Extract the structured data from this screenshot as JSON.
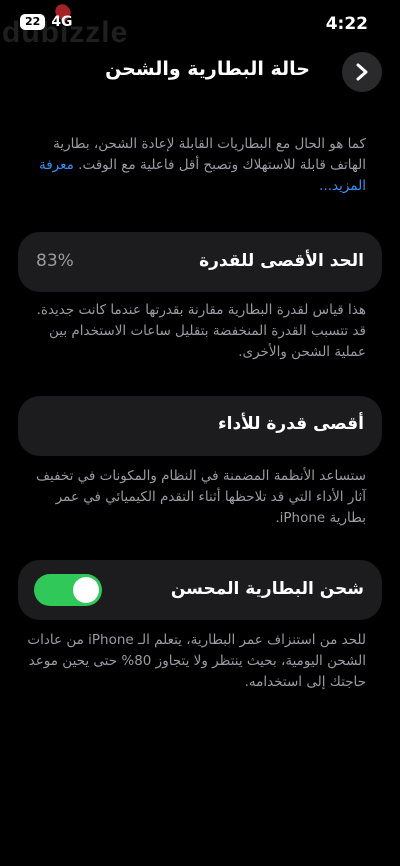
{
  "status_bar": {
    "time": "4:22",
    "battery_level": "22",
    "network": "4G"
  },
  "watermark": "dubizzle",
  "nav": {
    "title": "حالة البطارية والشحن",
    "back_icon": "chevron-right-icon"
  },
  "intro": {
    "text": "كما هو الحال مع البطاريات القابلة لإعادة الشحن، بطارية الهاتف قابلة للاستهلاك وتصبح أقل فاعلية مع الوقت.",
    "link": "معرفة المزيد..."
  },
  "max_capacity": {
    "label": "الحد الأقصى للقدرة",
    "value": "83%",
    "description": "هذا قياس لقدرة البطارية مقارنة بقدرتها عندما كانت جديدة. قد تتسبب القدرة المنخفضة بتقليل ساعات الاستخدام بين عملية الشحن والأخرى."
  },
  "peak_performance": {
    "label": "أقصى قدرة للأداء",
    "description": "ستساعد الأنظمة المضمنة في النظام والمكونات في تخفيف آثار الأداء التي قد تلاحظها أثناء التقدم الكيميائي في عمر بطارية iPhone."
  },
  "optimized_charging": {
    "label": "شحن البطارية المحسن",
    "enabled": true,
    "toggle_color": "#31c85a",
    "description": "للحد من استنزاف عمر البطارية، يتعلم الـ iPhone من عادات الشحن اليومية، بحيث ينتظر ولا يتجاوز 80% حتى يحين موعد حاجتك إلى استخدامه."
  }
}
